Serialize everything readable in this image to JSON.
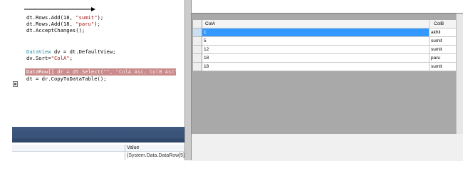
{
  "editor": {
    "lines": [
      {
        "type": "",
        "pre": "dt.Rows.Add(18, ",
        "str": "\"sumit\"",
        "post": ");"
      },
      {
        "type": "",
        "pre": "dt.Rows.Add(18, ",
        "str": "\"paru\"",
        "post": ");"
      },
      {
        "type": "",
        "pre": "dt.AcceptChanges();",
        "str": "",
        "post": ""
      },
      {
        "type": "DataView",
        "pre": " dv = dt.DefaultView;",
        "str": "",
        "post": ""
      },
      {
        "type": "",
        "pre": "dv.Sort=",
        "str": "\"ColA\"",
        "post": ";"
      },
      {
        "type": "",
        "pre": "dt = dr.CopyToDataTable();",
        "str": "",
        "post": ""
      }
    ],
    "highlighted": {
      "pre": "DataRow[] dr = dt.Select(",
      "str": "\"\", \"ColA Asc, ColB Asc\"",
      "post": ");"
    }
  },
  "watch": {
    "value_header": "Value",
    "value_cell": "{System.Data.DataRow[5]}"
  },
  "grid": {
    "columns": [
      "ColA",
      "ColB"
    ],
    "rows": [
      {
        "cola": "1",
        "colb": "akhil"
      },
      {
        "cola": "5",
        "colb": "sumit"
      },
      {
        "cola": "12",
        "colb": "sumit"
      },
      {
        "cola": "18",
        "colb": "paru"
      },
      {
        "cola": "18",
        "colb": "sumit"
      }
    ]
  },
  "colors": {
    "selection": "#3399ff",
    "highlight_line": "#c98b8b",
    "type_name": "#2b91af",
    "string": "#a31515",
    "grid_background": "#a9a9a9"
  }
}
